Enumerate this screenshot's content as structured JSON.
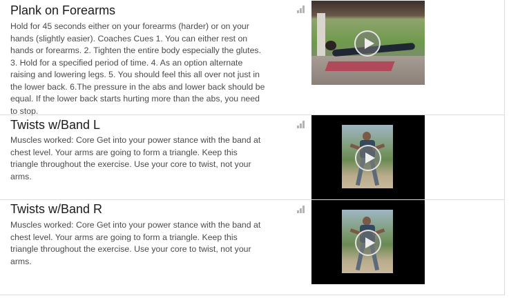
{
  "exercises": [
    {
      "title": "Plank on Forearms",
      "description": "Hold for 45 seconds either on your forearms (harder) or on your hands (slightly easier). Coaches Cues 1. You can either rest on hands or forearms. 2. Tighten the entire body especially the glutes. 3. Hold for a specified period of time. 4. As an option alternate raising and lowering legs. 5. You should feel this all over not just in the lower back. 6.The pressure in the abs and lower back should be equal. If the lower back starts hurting more than the abs, you need to stop.",
      "difficulty_icon": "signal-bars-icon",
      "video_icon": "play-icon"
    },
    {
      "title": "Twists w/Band L",
      "description": "Muscles worked: Core Get into your power stance with the band at chest level. Your arms are going to form a triangle. Keep this triangle throughout the exercise. Use your core to twist, not your arms.",
      "difficulty_icon": "signal-bars-icon",
      "video_icon": "play-icon"
    },
    {
      "title": "Twists w/Band R",
      "description": "Muscles worked: Core Get into your power stance with the band at chest level. Your arms are going to form a triangle. Keep this triangle throughout the exercise. Use your core to twist, not your arms.",
      "difficulty_icon": "signal-bars-icon",
      "video_icon": "play-icon"
    }
  ],
  "colors": {
    "title": "#1a1a1a",
    "text": "#4a4a4a",
    "divider": "#dcdcdc",
    "icon": "#b3b3b3",
    "video_bg": "#000000"
  }
}
